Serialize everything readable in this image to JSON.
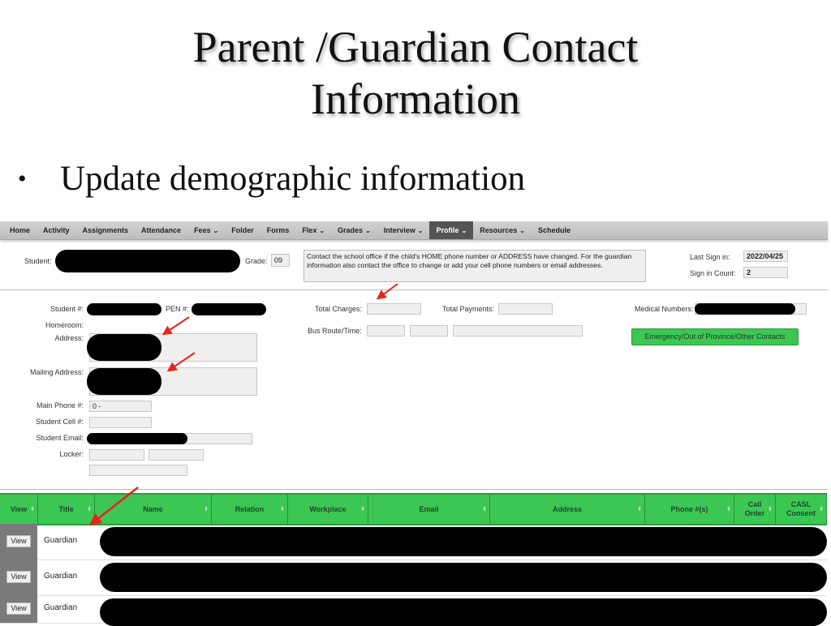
{
  "slide": {
    "title_line1": "Parent /Guardian Contact",
    "title_line2": "Information",
    "bullet": "Update demographic information"
  },
  "nav": {
    "items": [
      {
        "label": "Home",
        "dropdown": false,
        "active": false
      },
      {
        "label": "Activity",
        "dropdown": false,
        "active": false
      },
      {
        "label": "Assignments",
        "dropdown": false,
        "active": false
      },
      {
        "label": "Attendance",
        "dropdown": false,
        "active": false
      },
      {
        "label": "Fees",
        "dropdown": true,
        "active": false
      },
      {
        "label": "Folder",
        "dropdown": false,
        "active": false
      },
      {
        "label": "Forms",
        "dropdown": false,
        "active": false
      },
      {
        "label": "Flex",
        "dropdown": true,
        "active": false
      },
      {
        "label": "Grades",
        "dropdown": true,
        "active": false
      },
      {
        "label": "Interview",
        "dropdown": true,
        "active": false
      },
      {
        "label": "Profile",
        "dropdown": true,
        "active": true
      },
      {
        "label": "Resources",
        "dropdown": true,
        "active": false
      },
      {
        "label": "Schedule",
        "dropdown": false,
        "active": false
      }
    ],
    "chevron": "⌄"
  },
  "header": {
    "student_label": "Student:",
    "grade_label": "Grade:",
    "grade_value": "09",
    "notice": "Contact the school office if the child's HOME phone number  or ADDRESS have changed. For the guardian information also contact the office to change or add your cell phone numbers or email addresses.",
    "last_sign_in_label": "Last Sign in:",
    "last_sign_in_value": "2022/04/25",
    "sign_in_count_label": "Sign in Count:",
    "sign_in_count_value": "2"
  },
  "details": {
    "student_num_label": "Student #:",
    "pen_label": "PEN #:",
    "homeroom_label": "Homeroom:",
    "address_label": "Address:",
    "mailing_address_label": "Mailing Address:",
    "main_phone_label": "Main Phone #:",
    "main_phone_value": "0  -",
    "student_cell_label": "Student Cell #:",
    "student_email_label": "Student Email:",
    "locker_label": "Locker:",
    "total_charges_label": "Total Charges:",
    "total_payments_label": "Total Payments:",
    "bus_route_label": "Bus Route/Time:",
    "medical_numbers_label": "Medical Numbers:",
    "contacts_button": "Emergency/Out of Province/Other Contacts"
  },
  "table": {
    "sort_icon": "⬍",
    "columns": [
      "View",
      "Title",
      "Name",
      "Relation",
      "Workplace",
      "Email",
      "Address",
      "Phone #(s)",
      "Call Order",
      "CASL Consent"
    ],
    "rows": [
      {
        "view": "View",
        "title": "Guardian"
      },
      {
        "view": "View",
        "title": "Guardian"
      },
      {
        "view": "View",
        "title": "Guardian"
      }
    ]
  },
  "colors": {
    "accent_green": "#3cc653",
    "nav_active": "#555555",
    "annotation_red": "#e8231b"
  }
}
